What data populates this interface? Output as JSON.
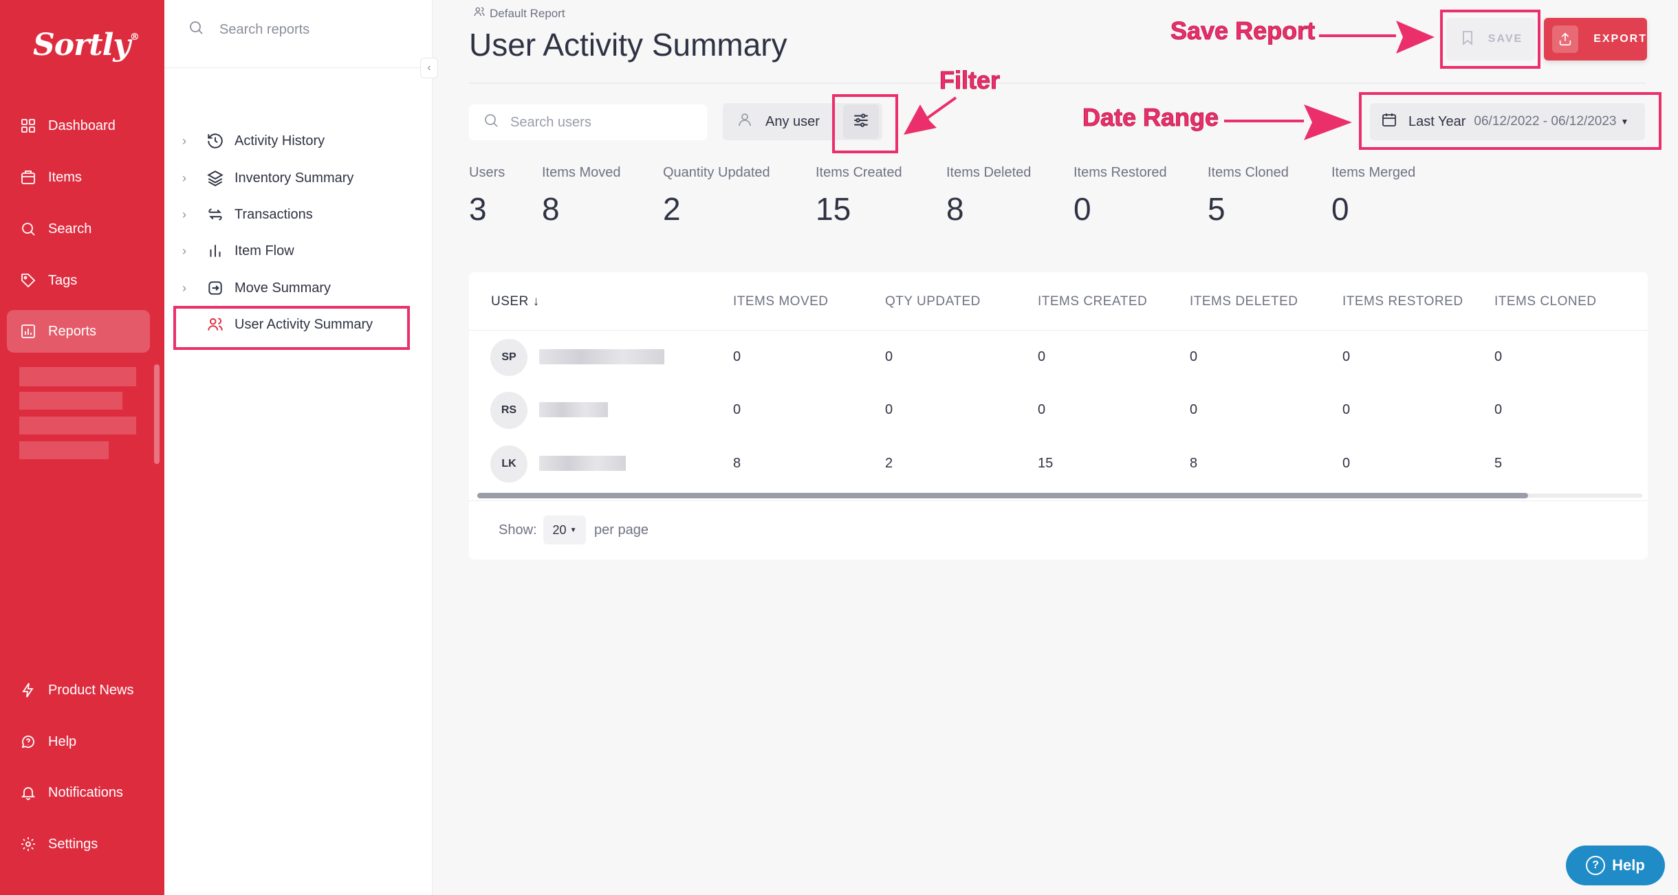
{
  "brand": {
    "logo_text": "Sortly",
    "logo_mark": "®"
  },
  "sidebar": {
    "items": [
      {
        "label": "Dashboard",
        "icon": "dashboard-icon"
      },
      {
        "label": "Items",
        "icon": "items-icon"
      },
      {
        "label": "Search",
        "icon": "search-icon"
      },
      {
        "label": "Tags",
        "icon": "tag-icon"
      },
      {
        "label": "Reports",
        "icon": "reports-icon",
        "active": true
      }
    ],
    "bottom_items": [
      {
        "label": "Product News",
        "icon": "lightning-icon"
      },
      {
        "label": "Help",
        "icon": "help-icon"
      },
      {
        "label": "Notifications",
        "icon": "bell-icon"
      },
      {
        "label": "Settings",
        "icon": "gear-icon"
      }
    ]
  },
  "reports_panel": {
    "search_placeholder": "Search reports",
    "items": [
      {
        "label": "Activity History",
        "icon": "history-icon"
      },
      {
        "label": "Inventory Summary",
        "icon": "layers-icon"
      },
      {
        "label": "Transactions",
        "icon": "transactions-icon"
      },
      {
        "label": "Item Flow",
        "icon": "bar-chart-icon"
      },
      {
        "label": "Move Summary",
        "icon": "move-icon"
      },
      {
        "label": "User Activity Summary",
        "icon": "users-icon",
        "active": true
      }
    ]
  },
  "header": {
    "breadcrumb": "Default Report",
    "title": "User Activity Summary",
    "save_label": "SAVE",
    "export_label": "EXPORT"
  },
  "toolbar": {
    "search_placeholder": "Search users",
    "user_filter": "Any user",
    "date_preset": "Last Year",
    "date_range": "06/12/2022 - 06/12/2023"
  },
  "stats": [
    {
      "label": "Users",
      "value": "3"
    },
    {
      "label": "Items Moved",
      "value": "8"
    },
    {
      "label": "Quantity Updated",
      "value": "2"
    },
    {
      "label": "Items Created",
      "value": "15"
    },
    {
      "label": "Items Deleted",
      "value": "8"
    },
    {
      "label": "Items Restored",
      "value": "0"
    },
    {
      "label": "Items Cloned",
      "value": "5"
    },
    {
      "label": "Items Merged",
      "value": "0"
    }
  ],
  "table": {
    "columns": [
      "USER",
      "ITEMS MOVED",
      "QTY UPDATED",
      "ITEMS CREATED",
      "ITEMS DELETED",
      "ITEMS RESTORED",
      "ITEMS CLONED"
    ],
    "sort_indicator": "↓",
    "rows": [
      {
        "initials": "SP",
        "values": [
          "0",
          "0",
          "0",
          "0",
          "0",
          "0"
        ]
      },
      {
        "initials": "RS",
        "values": [
          "0",
          "0",
          "0",
          "0",
          "0",
          "0"
        ]
      },
      {
        "initials": "LK",
        "values": [
          "8",
          "2",
          "15",
          "8",
          "0",
          "5"
        ]
      }
    ]
  },
  "pagination": {
    "show_label": "Show:",
    "per_page_value": "20",
    "per_page_label": "per page"
  },
  "help_button": {
    "label": "Help",
    "glyph": "?"
  },
  "annotations": {
    "save_report": "Save Report",
    "filter": "Filter",
    "date_range": "Date Range"
  },
  "colors": {
    "brand_red": "#de2c3f",
    "annotation_pink": "#ea2f6a",
    "help_blue": "#1f8bc7"
  }
}
